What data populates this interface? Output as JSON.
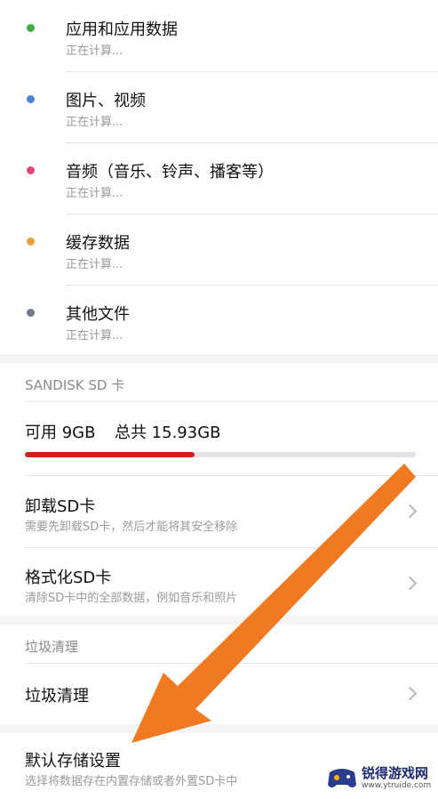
{
  "categories": [
    {
      "label": "应用和应用数据",
      "status": "正在计算...",
      "color": "#3fae3f"
    },
    {
      "label": "图片、视频",
      "status": "正在计算...",
      "color": "#4a86d8"
    },
    {
      "label": "音频（音乐、铃声、播客等）",
      "status": "正在计算...",
      "color": "#e0467c"
    },
    {
      "label": "缓存数据",
      "status": "正在计算...",
      "color": "#e9a23b"
    },
    {
      "label": "其他文件",
      "status": "正在计算...",
      "color": "#6e7a8a"
    }
  ],
  "sd_section": {
    "header": "SANDISK SD 卡",
    "available_label": "可用 9GB",
    "total_label": "总共 15.93GB",
    "used_fraction": 0.435,
    "used_color": "#d11f1f"
  },
  "unmount": {
    "title": "卸载SD卡",
    "subtitle": "需要先卸载SD卡，然后才能将其安全移除"
  },
  "format": {
    "title": "格式化SD卡",
    "subtitle": "清除SD卡中的全部数据，例如音乐和照片"
  },
  "trash_section": {
    "header": "垃圾清理",
    "item_title": "垃圾清理"
  },
  "default_storage": {
    "title": "默认存储设置",
    "subtitle": "选择将数据存在内置存储或者外置SD卡中"
  },
  "overlay_arrow": {
    "color": "#f07a22"
  },
  "watermark": {
    "name": "锐得游戏网",
    "url": "www.ytruide.com"
  }
}
